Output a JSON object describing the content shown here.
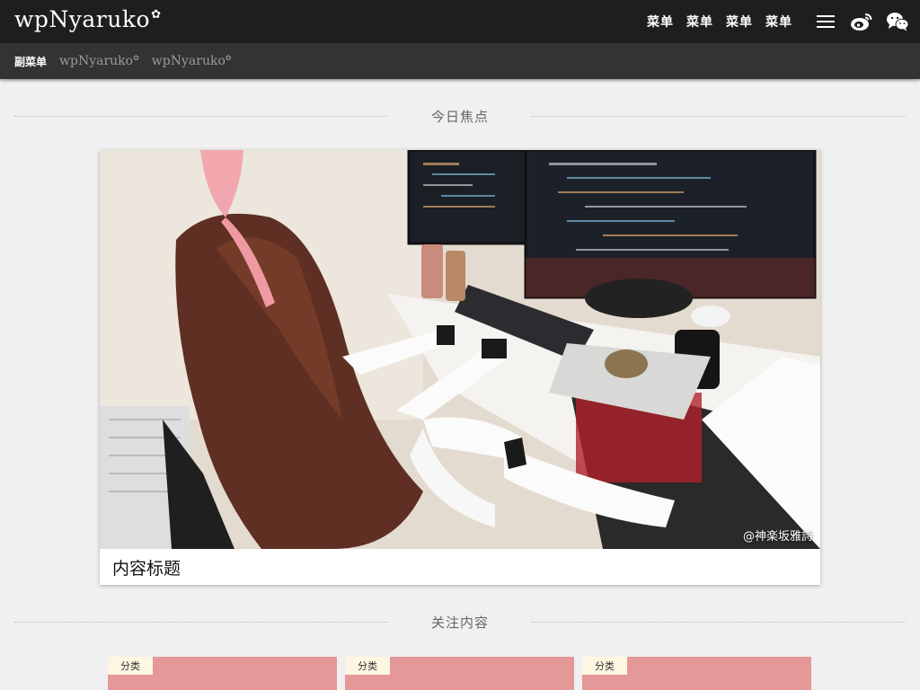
{
  "header": {
    "logo_text": "wpNyaruko",
    "nav": [
      "菜单",
      "菜单",
      "菜单",
      "菜单"
    ],
    "icons": [
      "menu-icon",
      "weibo-icon",
      "wechat-icon"
    ]
  },
  "subnav": {
    "main_label": "副菜单",
    "links": [
      "wpNyaruko",
      "wpNyaruko"
    ]
  },
  "sections": {
    "focus_title": "今日焦点",
    "follow_title": "关注内容"
  },
  "feature": {
    "photo_credit": "@神楽坂雅詩",
    "caption": "内容标题"
  },
  "cards": [
    {
      "category": "分类"
    },
    {
      "category": "分类"
    },
    {
      "category": "分类"
    }
  ],
  "colors": {
    "topbar": "#1e1e1e",
    "subbar": "#333333",
    "background": "#f0f0f0",
    "card_pink": "#e49898",
    "tag_bg": "#fcf6e2"
  }
}
